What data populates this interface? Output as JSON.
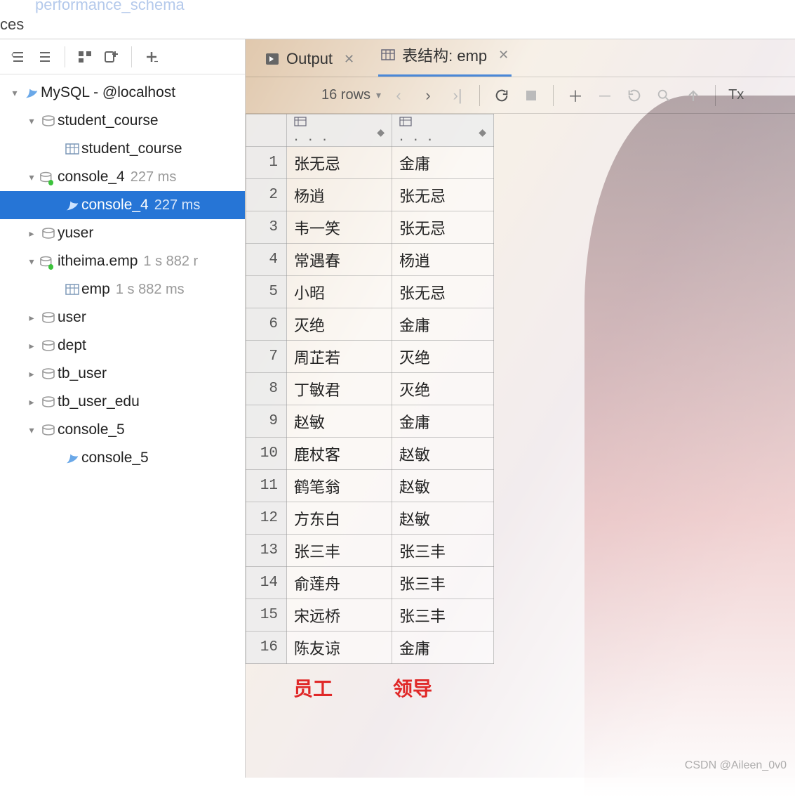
{
  "topstrip": {
    "faded": "performance_schema",
    "label": "ces"
  },
  "tree": {
    "root": {
      "label": "MySQL - @localhost"
    },
    "items": [
      {
        "type": "schema",
        "label": "student_course"
      },
      {
        "type": "table",
        "label": "student_course"
      },
      {
        "type": "run",
        "label": "console_4",
        "time": "227 ms"
      },
      {
        "type": "runsel",
        "label": "console_4",
        "time": "227 ms"
      },
      {
        "type": "schema",
        "label": "yuser"
      },
      {
        "type": "run",
        "label": "itheima.emp",
        "time": "1 s 882 r"
      },
      {
        "type": "table",
        "label": "emp",
        "time": "1 s 882 ms"
      },
      {
        "type": "schema",
        "label": "user"
      },
      {
        "type": "schema",
        "label": "dept"
      },
      {
        "type": "schema",
        "label": "tb_user"
      },
      {
        "type": "schema",
        "label": "tb_user_edu"
      },
      {
        "type": "schema",
        "label": "console_5"
      },
      {
        "type": "feather",
        "label": "console_5"
      }
    ]
  },
  "tabs": {
    "output": "Output",
    "struct": "表结构: emp"
  },
  "toolbar": {
    "rowcount": "16 rows",
    "tx": "Tx"
  },
  "grid": {
    "header_placeholder": ". . .",
    "rows": [
      {
        "n": "1",
        "c1": "张无忌",
        "c2": "金庸"
      },
      {
        "n": "2",
        "c1": "杨逍",
        "c2": "张无忌"
      },
      {
        "n": "3",
        "c1": "韦一笑",
        "c2": "张无忌"
      },
      {
        "n": "4",
        "c1": "常遇春",
        "c2": "杨逍"
      },
      {
        "n": "5",
        "c1": "小昭",
        "c2": "张无忌"
      },
      {
        "n": "6",
        "c1": "灭绝",
        "c2": "金庸"
      },
      {
        "n": "7",
        "c1": "周芷若",
        "c2": "灭绝"
      },
      {
        "n": "8",
        "c1": "丁敏君",
        "c2": "灭绝"
      },
      {
        "n": "9",
        "c1": "赵敏",
        "c2": "金庸"
      },
      {
        "n": "10",
        "c1": "鹿杖客",
        "c2": "赵敏"
      },
      {
        "n": "11",
        "c1": "鹤笔翁",
        "c2": "赵敏"
      },
      {
        "n": "12",
        "c1": "方东白",
        "c2": "赵敏"
      },
      {
        "n": "13",
        "c1": "张三丰",
        "c2": "张三丰"
      },
      {
        "n": "14",
        "c1": "俞莲舟",
        "c2": "张三丰"
      },
      {
        "n": "15",
        "c1": "宋远桥",
        "c2": "张三丰"
      },
      {
        "n": "16",
        "c1": "陈友谅",
        "c2": "金庸"
      }
    ]
  },
  "annot": {
    "col1": "员工",
    "col2": "领导"
  },
  "watermark": "CSDN @Aileen_0v0"
}
